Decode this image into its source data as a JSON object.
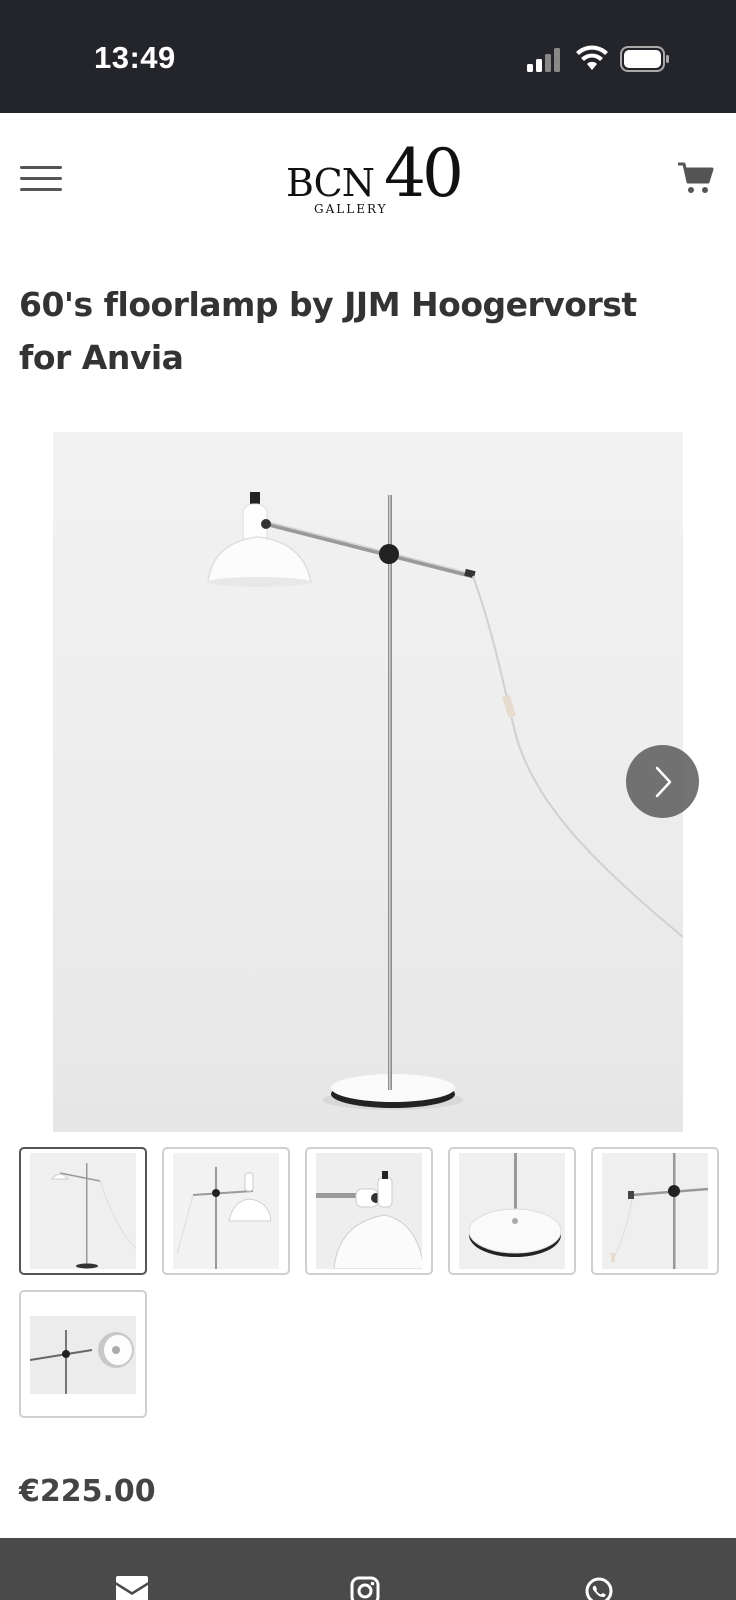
{
  "status_bar": {
    "time": "13:49",
    "icons": [
      "signal-icon",
      "wifi-icon",
      "battery-icon"
    ]
  },
  "header": {
    "menu_icon": "hamburger-menu-icon",
    "logo": {
      "brand": "BCN",
      "number": "40",
      "subtitle": "GALLERY"
    },
    "cart_icon": "cart-icon"
  },
  "product": {
    "title": "60's floorlamp by JJM Hoogervorst for Anvia",
    "price": "€225.00"
  },
  "gallery": {
    "next_icon": "chevron-right-icon",
    "thumbnails_count": 6,
    "active_thumbnail": 1
  },
  "footer": {
    "icons": [
      "email-icon",
      "instagram-icon",
      "whatsapp-icon"
    ]
  },
  "colors": {
    "status_bar_bg": "#24252a",
    "footer_bg": "#4a4a4a",
    "title_text": "#333333",
    "price_text": "#444444"
  }
}
